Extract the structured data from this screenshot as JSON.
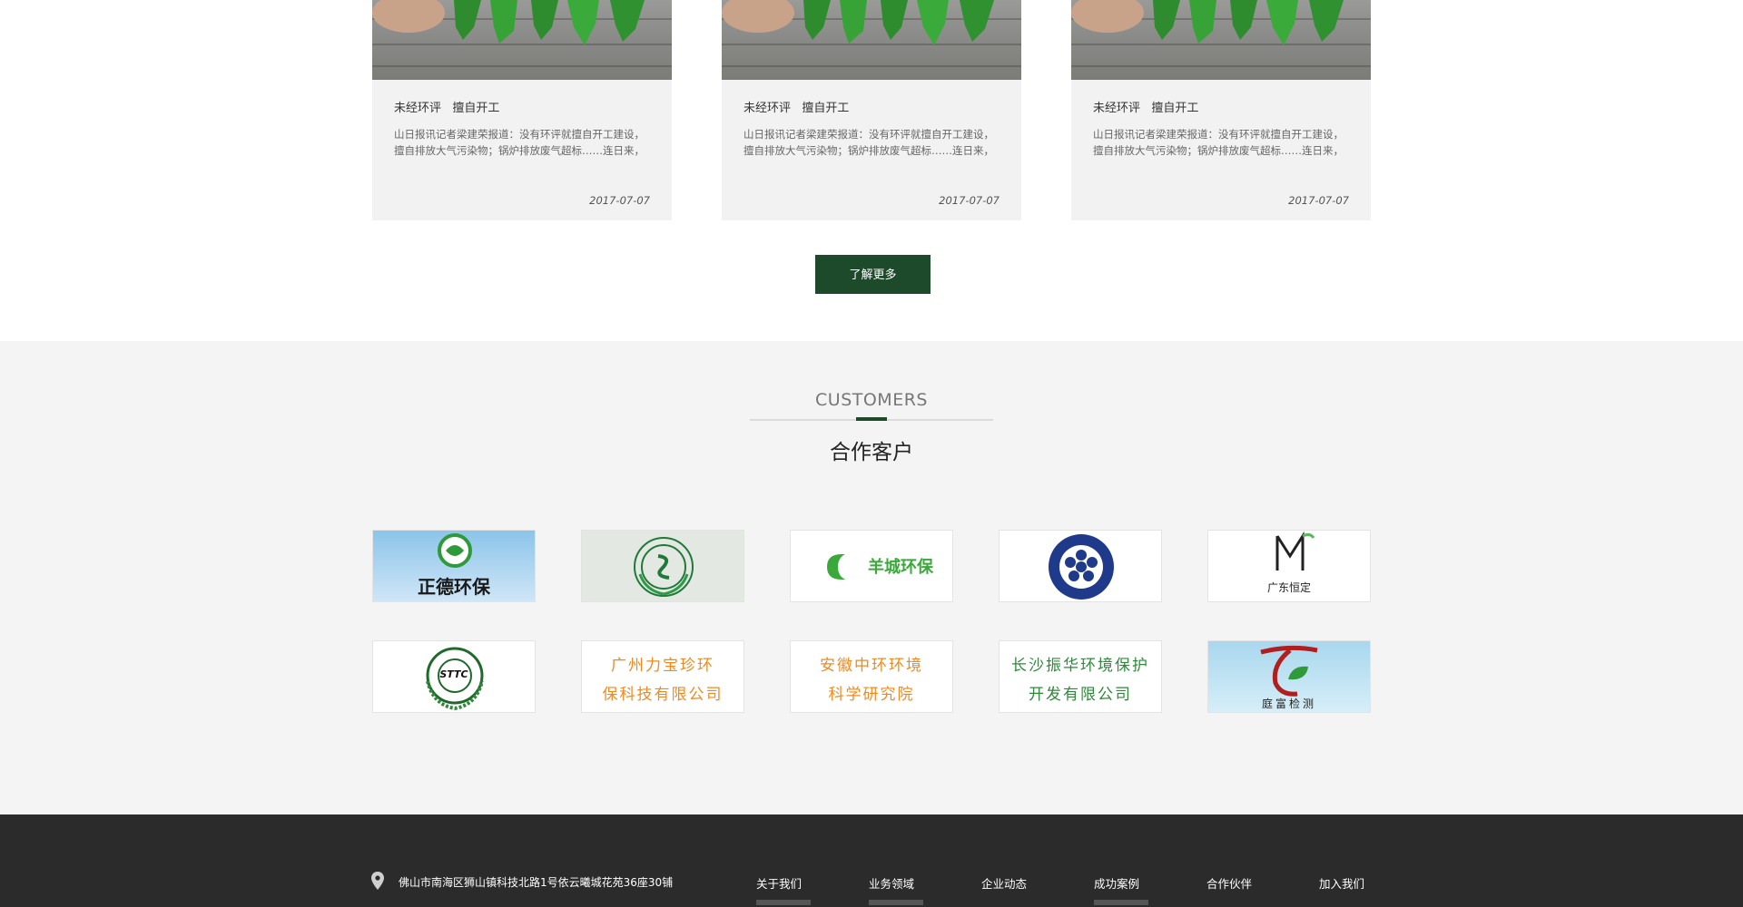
{
  "news": {
    "cards": [
      {
        "title": "未经环评   擅自开工",
        "desc": "山日报讯记者梁建荣报道：没有环评就擅自开工建设，擅自排放大气污染物；锅炉排放废气超标……连日来，",
        "date": "2017-07-07"
      },
      {
        "title": "未经环评   擅自开工",
        "desc": "山日报讯记者梁建荣报道：没有环评就擅自开工建设，擅自排放大气污染物；锅炉排放废气超标……连日来，",
        "date": "2017-07-07"
      },
      {
        "title": "未经环评   擅自开工",
        "desc": "山日报讯记者梁建荣报道：没有环评就擅自开工建设，擅自排放大气污染物；锅炉排放废气超标……连日来，",
        "date": "2017-07-07"
      }
    ],
    "more_label": "了解更多"
  },
  "customers": {
    "title_en": "CUSTOMERS",
    "title_cn": "合作客户",
    "logos": {
      "zhengde": "正德环保",
      "yangcheng": "羊城环保",
      "hengding": "广东恒定",
      "sttc": "STTC",
      "libaozhen_1": "广州力宝珍环",
      "libaozhen_2": "保科技有限公司",
      "anhui_1": "安徽中环环境",
      "anhui_2": "科学研究院",
      "changsha_1": "长沙振华环境保护",
      "changsha_2": "开发有限公司",
      "tingfu": "庭富检测"
    }
  },
  "footer": {
    "address": "佛山市南海区狮山镇科技北路1号依云曦城花苑36座30铺",
    "nav": [
      "关于我们",
      "业务领域",
      "企业动态",
      "成功案例",
      "合作伙伴",
      "加入我们"
    ]
  },
  "colors": {
    "accent": "#1d4a2a",
    "footer_bg": "#2b2b2b",
    "section_bg": "#f4f4f4",
    "logo_orange": "#f08a1e"
  }
}
